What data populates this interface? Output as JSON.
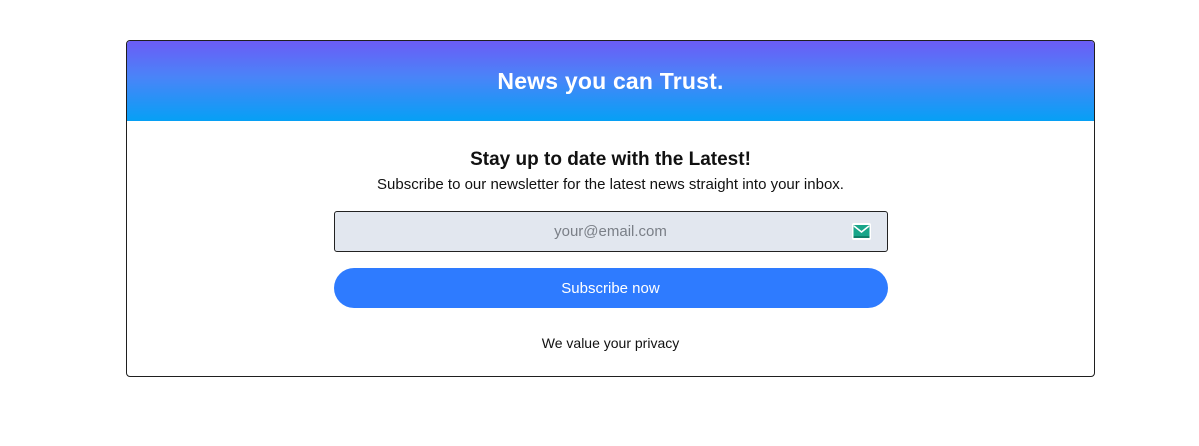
{
  "card": {
    "title": "News you can Trust."
  },
  "content": {
    "headline": "Stay up to date with the Latest!",
    "subtext": "Subscribe to our newsletter for the latest news straight into your inbox."
  },
  "email": {
    "placeholder": "your@email.com",
    "value": "",
    "icon": "mail-icon"
  },
  "subscribe": {
    "label": "Subscribe now"
  },
  "footer": {
    "privacy": "We value your privacy"
  },
  "colors": {
    "header_gradient_top": "#6b5cf6",
    "header_gradient_bottom": "#06a0f5",
    "button": "#2e7bff",
    "input_bg": "#e2e7ef",
    "icon_accent": "#17a589"
  }
}
